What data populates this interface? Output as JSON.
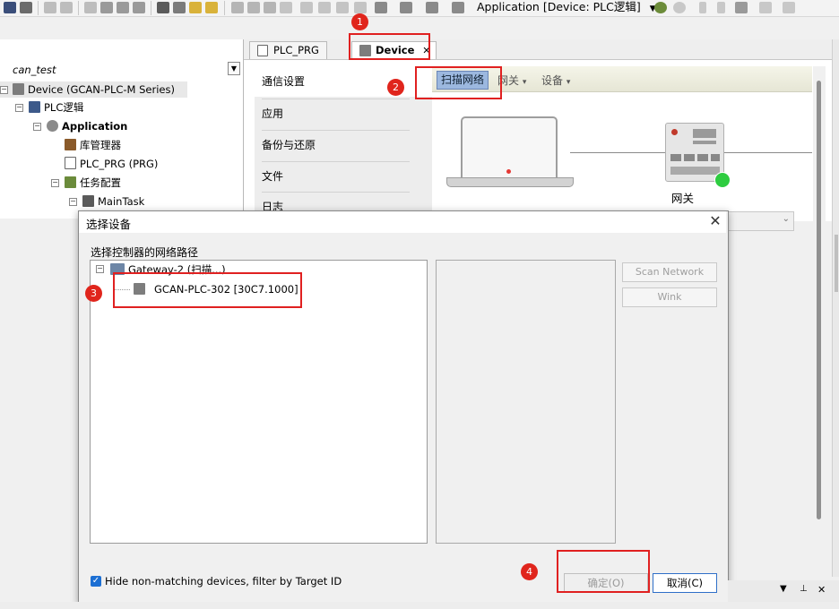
{
  "toolbar": {
    "app_combo": "Application [Device: PLC逻辑]",
    "icons": [
      "save-icon",
      "print-icon",
      "undo-icon",
      "redo-icon",
      "copy-icon",
      "paste-icon",
      "delete-icon",
      "find-icon",
      "replace-icon",
      "bookmark-icon",
      "build-icon",
      "online-icon",
      "login-icon",
      "run-icon",
      "stop-icon"
    ]
  },
  "tree": {
    "project": "can_test",
    "device": "Device (GCAN-PLC-M Series)",
    "plc_logic": "PLC逻辑",
    "application": "Application",
    "library_manager": "库管理器",
    "plc_prg": "PLC_PRG (PRG)",
    "task_config": "任务配置",
    "main_task": "MainTask"
  },
  "editor": {
    "tabs": [
      {
        "label": "PLC_PRG"
      },
      {
        "label": "Device"
      }
    ],
    "tab_close": "✕",
    "nav": [
      "通信设置",
      "应用",
      "备份与还原",
      "文件",
      "日志"
    ],
    "toolbar": {
      "scan": "扫描网络",
      "gateway": "网关",
      "device": "设备",
      "caret": "▾"
    },
    "gateway_label": "网关"
  },
  "dialog": {
    "title": "选择设备",
    "close": "✕",
    "sublabel": "选择控制器的网络路径",
    "gateway_node": "Gateway-2 (扫描...)",
    "device_node": "GCAN-PLC-302 [30C7.1000]",
    "scan_network": "Scan Network",
    "wink": "Wink",
    "hide_nonmatching": "Hide non-matching devices, filter by Target ID",
    "ok": "确定(O)",
    "cancel": "取消(C)"
  },
  "annotations": [
    "1",
    "2",
    "3",
    "4"
  ],
  "colors": {
    "annotation_red": "#e02020",
    "scan_button": "#9cb8df",
    "status_green": "#2ecc40",
    "checkbox_blue": "#1c6fd3"
  }
}
